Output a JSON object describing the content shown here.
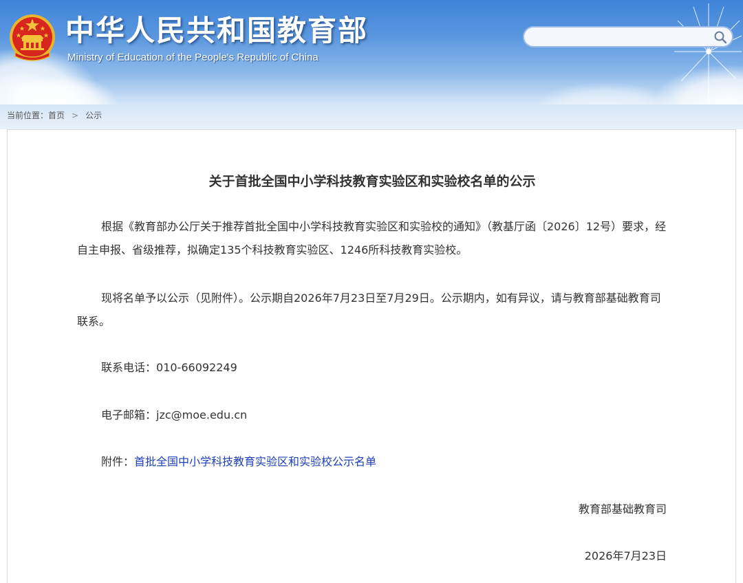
{
  "header": {
    "title": "中华人民共和国教育部",
    "subtitle": "Ministry of Education of the People's Republic of China",
    "emblem_icon": "national-emblem-icon",
    "search": {
      "value": "",
      "placeholder": "",
      "icon": "search-icon"
    }
  },
  "breadcrumb": {
    "prefix": "当前位置：",
    "items": [
      "首页",
      "公示"
    ],
    "separator": ">"
  },
  "article": {
    "title": "关于首批全国中小学科技教育实验区和实验校名单的公示",
    "paragraphs": [
      "根据《教育部办公厅关于推荐首批全国中小学科技教育实验区和实验校的通知》（教基厅函〔2026〕12号）要求，经自主申报、省级推荐，拟确定135个科技教育实验区、1246所科技教育实验校。",
      "现将名单予以公示（见附件）。公示期自2026年7月23日至7月29日。公示期内，如有异议，请与教育部基础教育司联系。"
    ],
    "phone_label": "联系电话：",
    "phone": "010-66092249",
    "email_label": "电子邮箱：",
    "email": "jzc@moe.edu.cn",
    "attachment_label": "附件：",
    "attachment_link": "首批全国中小学科技教育实验区和实验校公示名单",
    "signature": "教育部基础教育司",
    "date": "2026年7月23日"
  },
  "colors": {
    "header_blue": "#3f83d9",
    "link_blue": "#1e3fb8",
    "emblem_red": "#d7261e",
    "emblem_gold": "#f3c13a"
  }
}
